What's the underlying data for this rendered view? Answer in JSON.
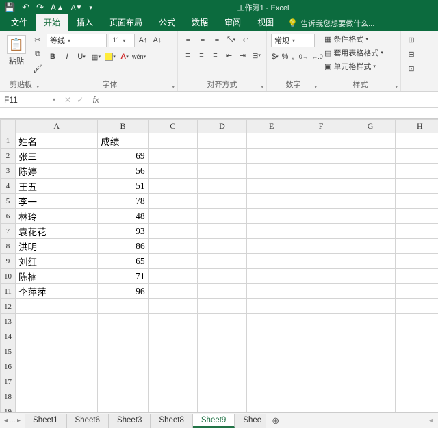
{
  "title": "工作簿1 - Excel",
  "tabs": {
    "file": "文件",
    "home": "开始",
    "insert": "插入",
    "layout": "页面布局",
    "formulas": "公式",
    "data": "数据",
    "review": "审阅",
    "view": "视图",
    "tellme": "告诉我您想要做什么..."
  },
  "ribbon": {
    "clipboard": {
      "paste": "粘贴",
      "label": "剪贴板"
    },
    "font": {
      "name": "等线",
      "size": "11",
      "label": "字体"
    },
    "align": {
      "label": "对齐方式"
    },
    "number": {
      "format": "常规",
      "label": "数字"
    },
    "styles": {
      "cond": "条件格式",
      "table": "套用表格格式",
      "cell": "单元格样式",
      "label": "样式"
    }
  },
  "namebox": "F11",
  "columns": [
    "A",
    "B",
    "C",
    "D",
    "E",
    "F",
    "G",
    "H"
  ],
  "rows": [
    "1",
    "2",
    "3",
    "4",
    "5",
    "6",
    "7",
    "8",
    "9",
    "10",
    "11",
    "12",
    "13",
    "14",
    "15",
    "16",
    "17",
    "18",
    "19"
  ],
  "data": {
    "header": [
      "姓名",
      "成绩"
    ],
    "rows": [
      [
        "张三",
        "69"
      ],
      [
        "陈婷",
        "56"
      ],
      [
        "王五",
        "51"
      ],
      [
        "李一",
        "78"
      ],
      [
        "林玲",
        "48"
      ],
      [
        "袁花花",
        "93"
      ],
      [
        "洪明",
        "86"
      ],
      [
        "刘红",
        "65"
      ],
      [
        "陈楠",
        "71"
      ],
      [
        "李萍萍",
        "96"
      ]
    ]
  },
  "sheets": {
    "items": [
      "Sheet1",
      "Sheet6",
      "Sheet3",
      "Sheet8",
      "Sheet9",
      "Shee"
    ],
    "active": "Sheet9"
  },
  "chart_data": {
    "type": "table",
    "columns": [
      "姓名",
      "成绩"
    ],
    "rows": [
      [
        "张三",
        69
      ],
      [
        "陈婷",
        56
      ],
      [
        "王五",
        51
      ],
      [
        "李一",
        78
      ],
      [
        "林玲",
        48
      ],
      [
        "袁花花",
        93
      ],
      [
        "洪明",
        86
      ],
      [
        "刘红",
        65
      ],
      [
        "陈楠",
        71
      ],
      [
        "李萍萍",
        96
      ]
    ]
  }
}
